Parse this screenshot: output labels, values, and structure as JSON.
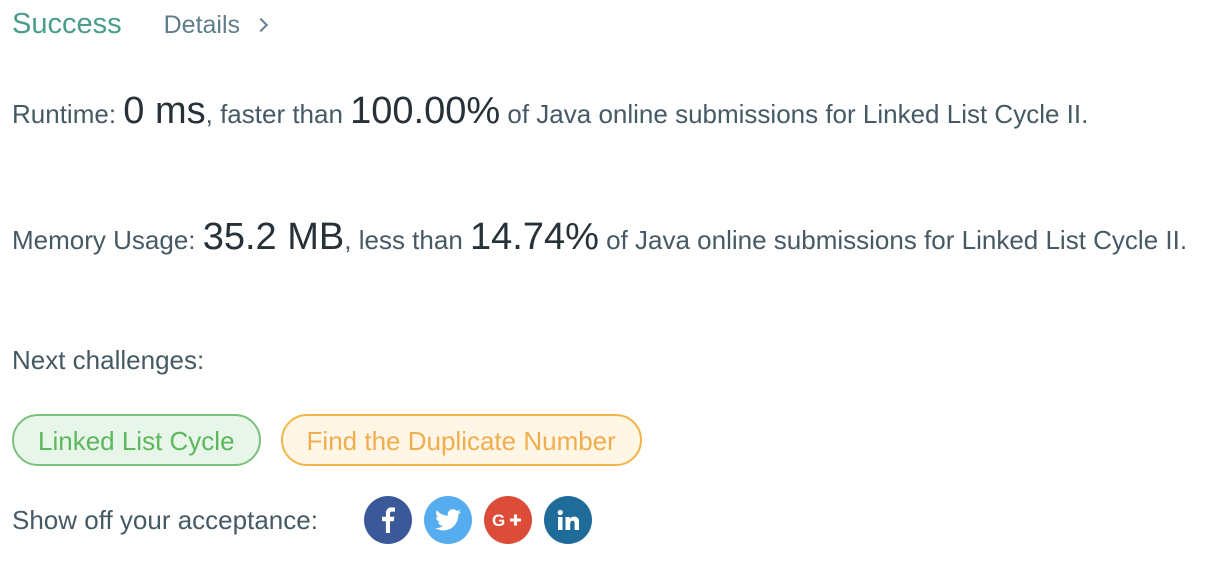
{
  "header": {
    "status": "Success",
    "details_label": "Details"
  },
  "runtime": {
    "label": "Runtime: ",
    "value": "0 ms",
    "middle": ", faster than ",
    "percent": "100.00%",
    "suffix": " of Java online submissions for Linked List Cycle II."
  },
  "memory": {
    "label": "Memory Usage: ",
    "value": "35.2 MB",
    "middle": ", less than ",
    "percent": "14.74%",
    "suffix": " of Java online submissions for Linked List Cycle II."
  },
  "next": {
    "label": "Next challenges:",
    "challenges": [
      {
        "title": "Linked List Cycle",
        "difficulty_color": "#5cb85c"
      },
      {
        "title": "Find the Duplicate Number",
        "difficulty_color": "#f0ad4e"
      }
    ]
  },
  "share": {
    "label": "Show off your acceptance:",
    "buttons": [
      {
        "icon": "facebook-icon",
        "color": "#3b5998"
      },
      {
        "icon": "twitter-icon",
        "color": "#55acee"
      },
      {
        "icon": "google-plus-icon",
        "color": "#dd4b39"
      },
      {
        "icon": "linkedin-icon",
        "color": "#1f6b9a"
      }
    ]
  },
  "colors": {
    "success": "#4a9c8d",
    "text": "#455a64"
  }
}
